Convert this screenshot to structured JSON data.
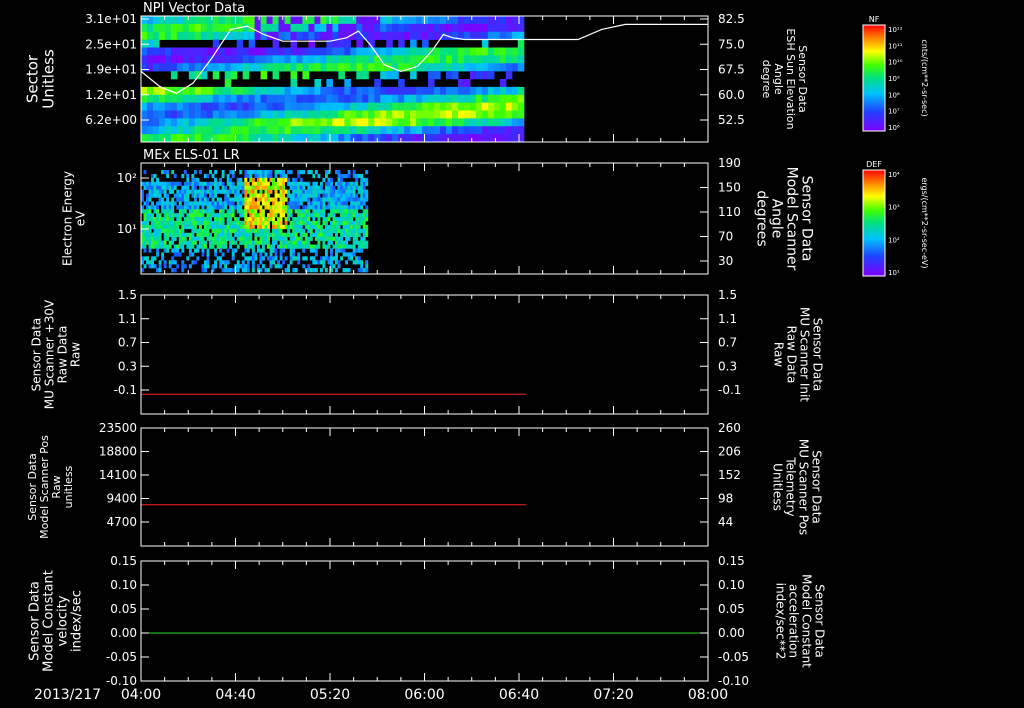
{
  "date_label": "2013/217",
  "time_ticks": [
    "04:00",
    "04:40",
    "05:20",
    "06:00",
    "06:40",
    "07:20",
    "08:00"
  ],
  "colors": {
    "background": "#000000",
    "frame": "#ffffff",
    "red_trace": "#ff2020",
    "green_trace": "#20e020"
  },
  "chart_data": [
    {
      "type": "heatmap",
      "title": "NPI Vector Data",
      "ylabel_left": [
        "Sector",
        "Unitless"
      ],
      "yticks_left": [
        "3.1e+01",
        "2.5e+01",
        "1.9e+01",
        "1.2e+01",
        "6.2e+00"
      ],
      "ylabel_right": [
        "Sensor Data",
        "ESH Sun Elevation",
        "Angle",
        "degree"
      ],
      "yticks_right": [
        "82.5",
        "75.0",
        "67.5",
        "60.0",
        "52.5"
      ],
      "data_end_time": "06:42",
      "overlay_line": {
        "name": "ESH Sun Elevation Angle",
        "x": [
          "04:00",
          "04:08",
          "04:15",
          "04:22",
          "04:30",
          "04:38",
          "04:45",
          "04:52",
          "05:00",
          "05:10",
          "05:20",
          "05:27",
          "05:32",
          "05:37",
          "05:43",
          "05:50",
          "05:57",
          "06:03",
          "06:08",
          "06:12",
          "06:17",
          "06:25",
          "06:40",
          "06:55",
          "07:05",
          "07:15",
          "07:25",
          "08:00"
        ],
        "y": [
          66,
          61.5,
          59.5,
          62.5,
          70,
          78.5,
          79.5,
          77,
          75,
          75,
          75,
          76,
          78,
          74,
          68,
          66,
          67.5,
          72,
          77,
          76,
          75.5,
          75.5,
          75.5,
          75.5,
          75.5,
          78.5,
          80,
          80
        ],
        "ylim": [
          45,
          82.5
        ]
      },
      "colorbar": {
        "label": "NF",
        "units": "cnts/(cm**2-sr-sec)",
        "ticks": [
          "10¹²",
          "10¹¹",
          "10¹⁰",
          "10⁹",
          "10⁸",
          "10⁷",
          "10⁶"
        ]
      }
    },
    {
      "type": "heatmap",
      "title": "MEx ELS-01 LR",
      "ylabel_left": [
        "Electron Energy",
        "eV"
      ],
      "yticks_left": [
        "10²",
        "10¹"
      ],
      "ylabel_right": [
        "Sensor Data",
        "Model Scanner",
        "Angle",
        "degrees"
      ],
      "yticks_right": [
        "190",
        "150",
        "110",
        "70",
        "30"
      ],
      "data_end_time": "05:36",
      "colorbar": {
        "label": "DEF",
        "units": "ergs/(cm**2-sr-sec-eV)",
        "ticks": [
          "10⁴",
          "10³",
          "10²",
          "10¹"
        ]
      }
    },
    {
      "type": "line",
      "ylabel_left": [
        "Sensor Data",
        "MU Scanner +30V",
        "Raw Data",
        "Raw"
      ],
      "yticks_left": [
        "1.5",
        "1.1",
        "0.7",
        "0.3",
        "-0.1"
      ],
      "ylabel_right": [
        "Sensor Data",
        "MU Scanner Init",
        "Raw Data",
        "Raw"
      ],
      "yticks_right": [
        "1.5",
        "1.1",
        "0.7",
        "0.3",
        "-0.1"
      ],
      "ylim": [
        -0.3,
        1.5
      ],
      "series": [
        {
          "x": [
            "04:00",
            "06:43"
          ],
          "y": [
            0,
            0
          ]
        }
      ]
    },
    {
      "type": "line",
      "ylabel_left": [
        "Sensor Data",
        "Model Scanner Pos",
        "Raw",
        "unitless"
      ],
      "yticks_left": [
        "23500",
        "18800",
        "14100",
        "9400",
        "4700"
      ],
      "ylabel_right": [
        "Sensor Data",
        "MU Scanner Pos",
        "Telemetry",
        "Unitless"
      ],
      "yticks_right": [
        "260",
        "206",
        "152",
        "98",
        "44"
      ],
      "ylim": [
        0,
        23500
      ],
      "series": [
        {
          "x": [
            "04:00",
            "06:43"
          ],
          "y": [
            8200,
            8200
          ]
        }
      ]
    },
    {
      "type": "line",
      "ylabel_left": [
        "Sensor Data",
        "Model Constant",
        "velocity",
        "index/sec"
      ],
      "yticks_left": [
        "0.15",
        "0.10",
        "0.05",
        "0.00",
        "-0.05",
        "-0.10"
      ],
      "ylabel_right": [
        "Sensor Data",
        "Model Constant",
        "acceleration",
        "index/sec**2"
      ],
      "yticks_right": [
        "0.15",
        "0.10",
        "0.05",
        "0.00",
        "-0.05",
        "-0.10"
      ],
      "ylim": [
        -0.1,
        0.15
      ],
      "series": [
        {
          "x": [
            "04:00",
            "08:00"
          ],
          "y": [
            0,
            0
          ]
        }
      ]
    }
  ]
}
